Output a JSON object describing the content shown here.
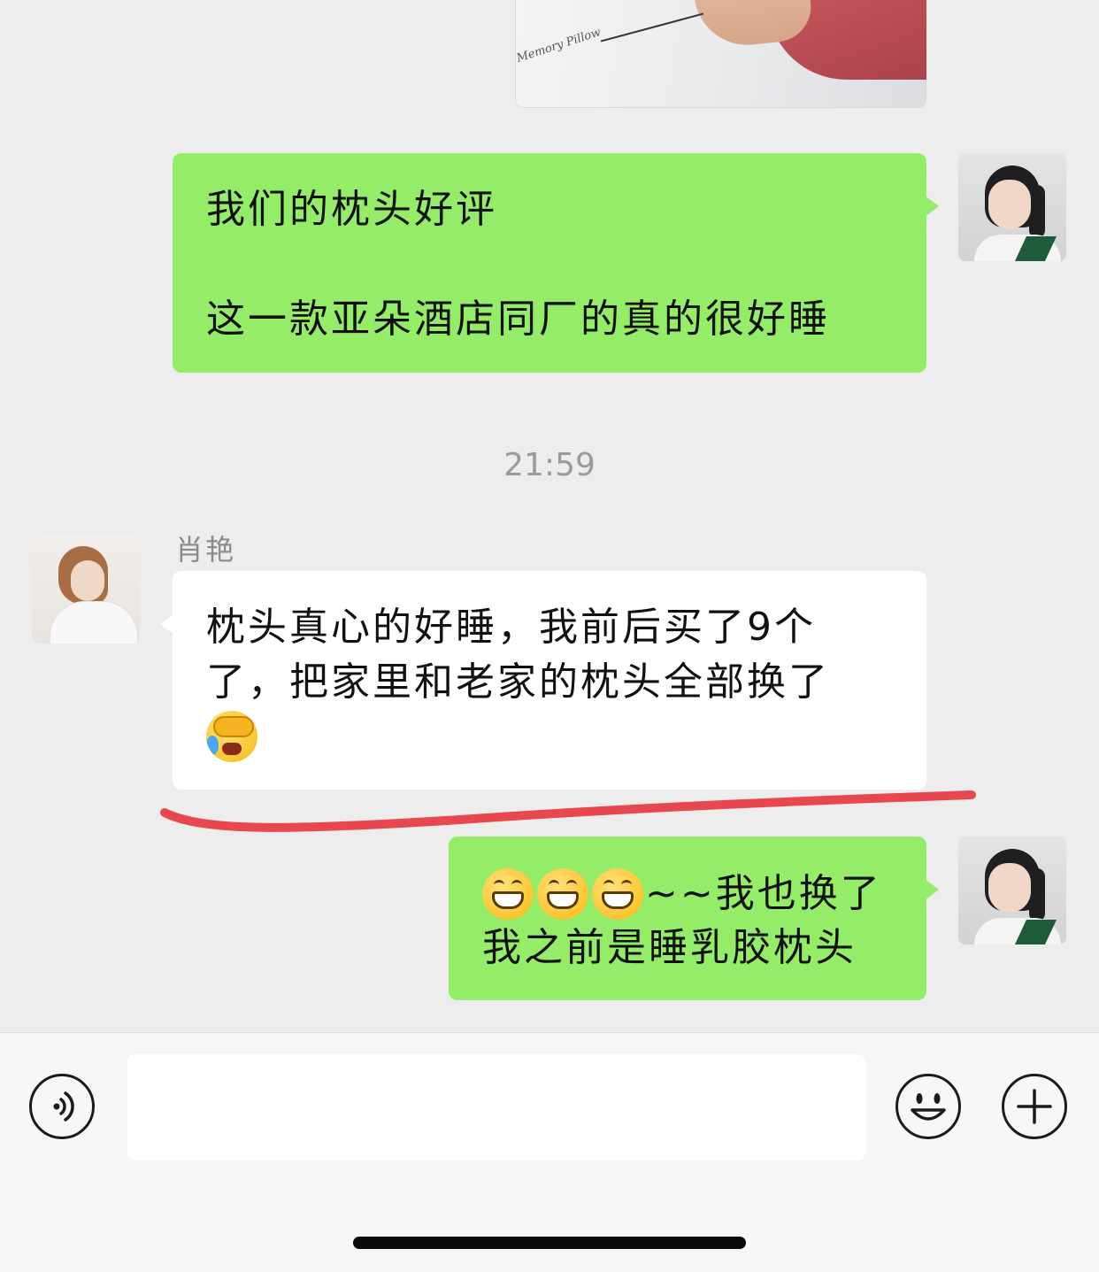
{
  "chat": {
    "top_image": {
      "caption_text": "Memory Pillow"
    },
    "messages": [
      {
        "from": "me",
        "lines": [
          "我们的枕头好评",
          "",
          "这一款亚朵酒店同厂的真的很好睡"
        ]
      },
      {
        "timestamp": "21:59"
      },
      {
        "from": "other",
        "sender_name": "肖艳",
        "lines": [
          "枕头真心的好睡，我前后买了9个",
          "了，把家里和老家的枕头全部换了"
        ],
        "trailing_emoji": "face-palm-crying-emoji"
      },
      {
        "from": "me",
        "lines": [
          "~~我也换了",
          "我之前是睡乳胶枕头"
        ],
        "leading_emojis": [
          "grinning-emoji",
          "grinning-emoji",
          "grinning-emoji"
        ]
      }
    ],
    "annotation": {
      "type": "red-underline",
      "color": "#e8474f"
    }
  },
  "input_bar": {
    "voice_icon": "voice-icon",
    "text_value": "",
    "emoji_icon": "emoji-icon",
    "plus_icon": "plus-icon"
  },
  "colors": {
    "background": "#ededed",
    "my_bubble": "#95ec69",
    "other_bubble": "#ffffff",
    "timestamp_text": "#9a9a9a",
    "annotation_red": "#e8474f"
  }
}
